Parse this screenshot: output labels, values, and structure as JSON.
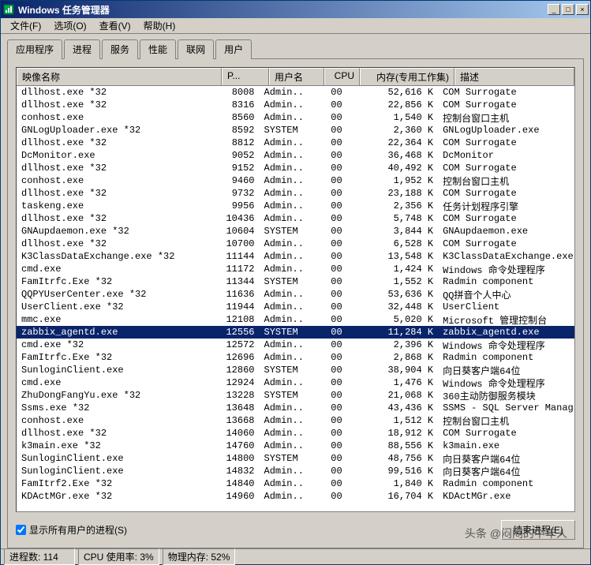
{
  "window": {
    "title": "Windows 任务管理器"
  },
  "menu": {
    "file": "文件(F)",
    "options": "选项(O)",
    "view": "查看(V)",
    "help": "帮助(H)"
  },
  "tabs": {
    "applications": "应用程序",
    "processes": "进程",
    "services": "服务",
    "performance": "性能",
    "networking": "联网",
    "users": "用户"
  },
  "columns": {
    "image_name": "映像名称",
    "pid": "P...",
    "user": "用户名",
    "cpu": "CPU",
    "memory": "内存(专用工作集)",
    "description": "描述"
  },
  "processes": [
    {
      "name": "dllhost.exe *32",
      "pid": "8008",
      "user": "Admin..",
      "cpu": "00",
      "mem": "52,616 K",
      "desc": "COM Surrogate",
      "sel": false
    },
    {
      "name": "dllhost.exe *32",
      "pid": "8316",
      "user": "Admin..",
      "cpu": "00",
      "mem": "22,856 K",
      "desc": "COM Surrogate",
      "sel": false
    },
    {
      "name": "conhost.exe",
      "pid": "8560",
      "user": "Admin..",
      "cpu": "00",
      "mem": "1,540 K",
      "desc": "控制台窗口主机",
      "sel": false
    },
    {
      "name": "GNLogUploader.exe *32",
      "pid": "8592",
      "user": "SYSTEM",
      "cpu": "00",
      "mem": "2,360 K",
      "desc": "GNLogUploader.exe",
      "sel": false
    },
    {
      "name": "dllhost.exe *32",
      "pid": "8812",
      "user": "Admin..",
      "cpu": "00",
      "mem": "22,364 K",
      "desc": "COM Surrogate",
      "sel": false
    },
    {
      "name": "DcMonitor.exe",
      "pid": "9052",
      "user": "Admin..",
      "cpu": "00",
      "mem": "36,468 K",
      "desc": "DcMonitor",
      "sel": false
    },
    {
      "name": "dllhost.exe *32",
      "pid": "9152",
      "user": "Admin..",
      "cpu": "00",
      "mem": "40,492 K",
      "desc": "COM Surrogate",
      "sel": false
    },
    {
      "name": "conhost.exe",
      "pid": "9460",
      "user": "Admin..",
      "cpu": "00",
      "mem": "1,952 K",
      "desc": "控制台窗口主机",
      "sel": false
    },
    {
      "name": "dllhost.exe *32",
      "pid": "9732",
      "user": "Admin..",
      "cpu": "00",
      "mem": "23,188 K",
      "desc": "COM Surrogate",
      "sel": false
    },
    {
      "name": "taskeng.exe",
      "pid": "9956",
      "user": "Admin..",
      "cpu": "00",
      "mem": "2,356 K",
      "desc": "任务计划程序引擎",
      "sel": false
    },
    {
      "name": "dllhost.exe *32",
      "pid": "10436",
      "user": "Admin..",
      "cpu": "00",
      "mem": "5,748 K",
      "desc": "COM Surrogate",
      "sel": false
    },
    {
      "name": "GNAupdaemon.exe *32",
      "pid": "10604",
      "user": "SYSTEM",
      "cpu": "00",
      "mem": "3,844 K",
      "desc": "GNAupdaemon.exe",
      "sel": false
    },
    {
      "name": "dllhost.exe *32",
      "pid": "10700",
      "user": "Admin..",
      "cpu": "00",
      "mem": "6,528 K",
      "desc": "COM Surrogate",
      "sel": false
    },
    {
      "name": "K3ClassDataExchange.exe *32",
      "pid": "11144",
      "user": "Admin..",
      "cpu": "00",
      "mem": "13,548 K",
      "desc": "K3ClassDataExchange.exe",
      "sel": false
    },
    {
      "name": "cmd.exe",
      "pid": "11172",
      "user": "Admin..",
      "cpu": "00",
      "mem": "1,424 K",
      "desc": "Windows 命令处理程序",
      "sel": false
    },
    {
      "name": "FamItrfc.Exe *32",
      "pid": "11344",
      "user": "SYSTEM",
      "cpu": "00",
      "mem": "1,552 K",
      "desc": "Radmin component",
      "sel": false
    },
    {
      "name": "QQPYUserCenter.exe *32",
      "pid": "11636",
      "user": "Admin..",
      "cpu": "00",
      "mem": "53,636 K",
      "desc": "QQ拼音个人中心",
      "sel": false
    },
    {
      "name": "UserClient.exe *32",
      "pid": "11944",
      "user": "Admin..",
      "cpu": "00",
      "mem": "32,448 K",
      "desc": "UserClient",
      "sel": false
    },
    {
      "name": "mmc.exe",
      "pid": "12108",
      "user": "Admin..",
      "cpu": "00",
      "mem": "5,020 K",
      "desc": "Microsoft 管理控制台",
      "sel": false
    },
    {
      "name": "zabbix_agentd.exe",
      "pid": "12556",
      "user": "SYSTEM",
      "cpu": "00",
      "mem": "11,284 K",
      "desc": "zabbix_agentd.exe",
      "sel": true
    },
    {
      "name": "cmd.exe *32",
      "pid": "12572",
      "user": "Admin..",
      "cpu": "00",
      "mem": "2,396 K",
      "desc": "Windows 命令处理程序",
      "sel": false
    },
    {
      "name": "FamItrfc.Exe *32",
      "pid": "12696",
      "user": "Admin..",
      "cpu": "00",
      "mem": "2,868 K",
      "desc": "Radmin component",
      "sel": false
    },
    {
      "name": "SunloginClient.exe",
      "pid": "12860",
      "user": "SYSTEM",
      "cpu": "00",
      "mem": "38,904 K",
      "desc": "向日葵客户端64位",
      "sel": false
    },
    {
      "name": "cmd.exe",
      "pid": "12924",
      "user": "Admin..",
      "cpu": "00",
      "mem": "1,476 K",
      "desc": "Windows 命令处理程序",
      "sel": false
    },
    {
      "name": "ZhuDongFangYu.exe *32",
      "pid": "13228",
      "user": "SYSTEM",
      "cpu": "00",
      "mem": "21,068 K",
      "desc": "360主动防御服务模块",
      "sel": false
    },
    {
      "name": "Ssms.exe *32",
      "pid": "13648",
      "user": "Admin..",
      "cpu": "00",
      "mem": "43,436 K",
      "desc": "SSMS - SQL Server Manag",
      "sel": false
    },
    {
      "name": "conhost.exe",
      "pid": "13668",
      "user": "Admin..",
      "cpu": "00",
      "mem": "1,512 K",
      "desc": "控制台窗口主机",
      "sel": false
    },
    {
      "name": "dllhost.exe *32",
      "pid": "14060",
      "user": "Admin..",
      "cpu": "00",
      "mem": "18,912 K",
      "desc": "COM Surrogate",
      "sel": false
    },
    {
      "name": "k3main.exe *32",
      "pid": "14760",
      "user": "Admin..",
      "cpu": "00",
      "mem": "88,556 K",
      "desc": "k3main.exe",
      "sel": false
    },
    {
      "name": "SunloginClient.exe",
      "pid": "14800",
      "user": "SYSTEM",
      "cpu": "00",
      "mem": "48,756 K",
      "desc": "向日葵客户端64位",
      "sel": false
    },
    {
      "name": "SunloginClient.exe",
      "pid": "14832",
      "user": "Admin..",
      "cpu": "00",
      "mem": "99,516 K",
      "desc": "向日葵客户端64位",
      "sel": false
    },
    {
      "name": "FamItrf2.Exe *32",
      "pid": "14840",
      "user": "Admin..",
      "cpu": "00",
      "mem": "1,840 K",
      "desc": "Radmin component",
      "sel": false
    },
    {
      "name": "KDActMGr.exe *32",
      "pid": "14960",
      "user": "Admin..",
      "cpu": "00",
      "mem": "16,704 K",
      "desc": "KDActMGr.exe",
      "sel": false
    }
  ],
  "controls": {
    "show_all_users": "显示所有用户的进程(S)",
    "show_all_users_checked": true,
    "end_process": "结束进程(E)"
  },
  "statusbar": {
    "processes": "进程数: 114",
    "cpu": "CPU 使用率: 3%",
    "memory": "物理内存: 52%"
  },
  "watermark": "头条 @闷闷的中年人"
}
